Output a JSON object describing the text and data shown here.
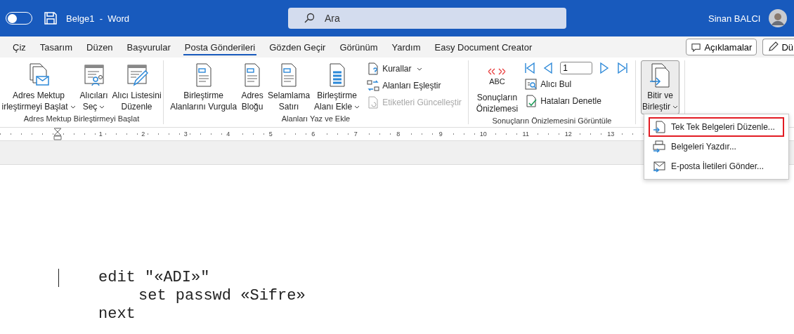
{
  "title_bar": {
    "autosave_on": false,
    "title": "Belge1  -  Word",
    "search": {
      "placeholder": "Ara"
    },
    "user": "Sinan BALCI"
  },
  "tabs": [
    {
      "label": "Çiz",
      "selected": false
    },
    {
      "label": "Tasarım",
      "selected": false
    },
    {
      "label": "Düzen",
      "selected": false
    },
    {
      "label": "Başvurular",
      "selected": false
    },
    {
      "label": "Posta Gönderileri",
      "selected": true
    },
    {
      "label": "Gözden Geçir",
      "selected": false
    },
    {
      "label": "Görünüm",
      "selected": false
    },
    {
      "label": "Yardım",
      "selected": false
    },
    {
      "label": "Easy Document Creator",
      "selected": false
    }
  ],
  "tab_actions": [
    {
      "kind": "comments",
      "label": "Açıklamalar"
    },
    {
      "kind": "edit",
      "label": "Dü"
    }
  ],
  "ribbon_groups": [
    {
      "label": "Adres Mektup Birleştirmeyi Başlat",
      "items": [
        {
          "kind": "large",
          "lines": [
            "Adres Mektup",
            "irleştirmeyi Başlat"
          ],
          "dropdown": true,
          "pressed": false
        },
        {
          "kind": "large",
          "lines": [
            "Alıcıları",
            "Seç"
          ],
          "dropdown": true,
          "pressed": false
        },
        {
          "kind": "large",
          "lines": [
            "Alıcı Listesini",
            "Düzenle"
          ],
          "dropdown": false,
          "pressed": false
        }
      ]
    },
    {
      "label": "Alanları Yaz ve Ekle",
      "items": [
        {
          "kind": "large",
          "lines": [
            "Birleştirme",
            "Alanlarını Vurgula"
          ],
          "dropdown": false,
          "pressed": false
        },
        {
          "kind": "large",
          "lines": [
            "Adres",
            "Bloğu"
          ],
          "dropdown": false,
          "pressed": false
        },
        {
          "kind": "large",
          "lines": [
            "Selamlama",
            "Satırı"
          ],
          "dropdown": false,
          "pressed": false
        },
        {
          "kind": "large",
          "lines": [
            "Birleştirme",
            "Alanı Ekle"
          ],
          "dropdown": true,
          "pressed": false
        },
        {
          "kind": "stack",
          "rows": [
            {
              "kind": "small",
              "label": "Kurallar",
              "dropdown": true,
              "disabled": false
            },
            {
              "kind": "small",
              "label": "Alanları Eşleştir",
              "dropdown": false,
              "disabled": false
            },
            {
              "kind": "small",
              "label": "Etiketleri Güncelleştir",
              "dropdown": false,
              "disabled": true
            }
          ]
        }
      ]
    },
    {
      "label": "Sonuçların Önizlemesini Görüntüle",
      "items": [
        {
          "kind": "large",
          "icon_text": "ABC",
          "lines": [
            "Sonuçların",
            "Önizlemesi"
          ],
          "dropdown": false,
          "pressed": false
        },
        {
          "kind": "stack",
          "rows": [
            {
              "kind": "nav",
              "record": "1"
            },
            {
              "kind": "small",
              "label": "Alıcı Bul",
              "dropdown": false,
              "disabled": false
            },
            {
              "kind": "small",
              "label": "Hataları Denetle",
              "dropdown": false,
              "disabled": false
            }
          ]
        }
      ]
    },
    {
      "items": [
        {
          "kind": "large",
          "lines": [
            "Bitir ve",
            "Birleştir"
          ],
          "dropdown": true,
          "pressed": true
        }
      ]
    }
  ],
  "ruler": [
    "1",
    "2",
    "3",
    "4",
    "5",
    "6",
    "7",
    "8",
    "9",
    "10",
    "11",
    "12",
    "13"
  ],
  "document": {
    "lines": [
      {
        "text": "edit \"«ADI»\"",
        "children": [
          {
            "text": "set passwd «Sifre»"
          }
        ]
      },
      {
        "text": "next"
      }
    ]
  },
  "menu": {
    "items": [
      {
        "label": "Tek Tek Belgeleri Düzenle...",
        "selected": true
      },
      {
        "label": "Belgeleri Yazdır...",
        "selected": false
      },
      {
        "label": "E-posta İletileri Gönder...",
        "selected": false
      }
    ]
  }
}
